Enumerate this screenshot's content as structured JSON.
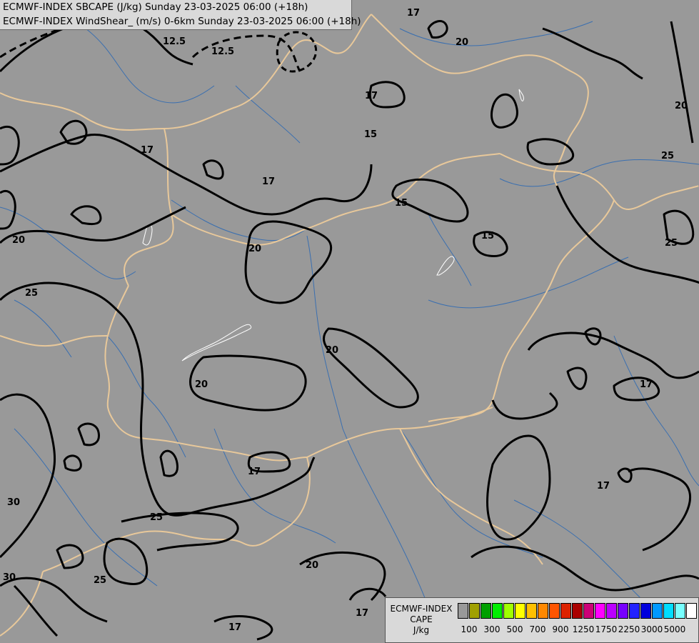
{
  "titles": {
    "line1": "ECMWF-INDEX SBCAPE (J/kg) Sunday 23-03-2025 06:00 (+18h)",
    "line2": "ECMWF-INDEX WindShear_ (m/s) 0-6km Sunday 23-03-2025 06:00 (+18h)"
  },
  "contour_labels": [
    {
      "text": "17"
    },
    {
      "text": "12.5"
    },
    {
      "text": "12.5"
    },
    {
      "text": "20"
    },
    {
      "text": "17"
    },
    {
      "text": "15"
    },
    {
      "text": "17"
    },
    {
      "text": "17"
    },
    {
      "text": "15"
    },
    {
      "text": "20"
    },
    {
      "text": "20"
    },
    {
      "text": "25"
    },
    {
      "text": "15"
    },
    {
      "text": "25"
    },
    {
      "text": "25"
    },
    {
      "text": "20"
    },
    {
      "text": "20"
    },
    {
      "text": "17"
    },
    {
      "text": "17"
    },
    {
      "text": "30"
    },
    {
      "text": "25"
    },
    {
      "text": "17"
    },
    {
      "text": "20"
    },
    {
      "text": "25"
    },
    {
      "text": "30"
    },
    {
      "text": "20"
    },
    {
      "text": "17"
    },
    {
      "text": "17"
    }
  ],
  "legend": {
    "label_line1": "ECMWF-INDEX",
    "label_line2": "CAPE",
    "label_line3": "J/kg",
    "swatch_colors": [
      "#999999",
      "#a0a000",
      "#00a000",
      "#00ee00",
      "#a0ff00",
      "#ffff00",
      "#ffc000",
      "#ff8800",
      "#ff5500",
      "#dd2200",
      "#aa0000",
      "#cc0077",
      "#ff00ff",
      "#bb00ff",
      "#7700ff",
      "#2222ff",
      "#0000dd",
      "#0099ff",
      "#00ddff",
      "#77ffff",
      "#ffffff"
    ],
    "ticks": [
      "100",
      "300",
      "500",
      "700",
      "900",
      "1250",
      "1750",
      "2250",
      "3000",
      "5000"
    ]
  },
  "colors": {
    "background": "#999999",
    "borders": "#e8c89a",
    "rivers": "#3a6fb0",
    "contours": "#000000"
  }
}
